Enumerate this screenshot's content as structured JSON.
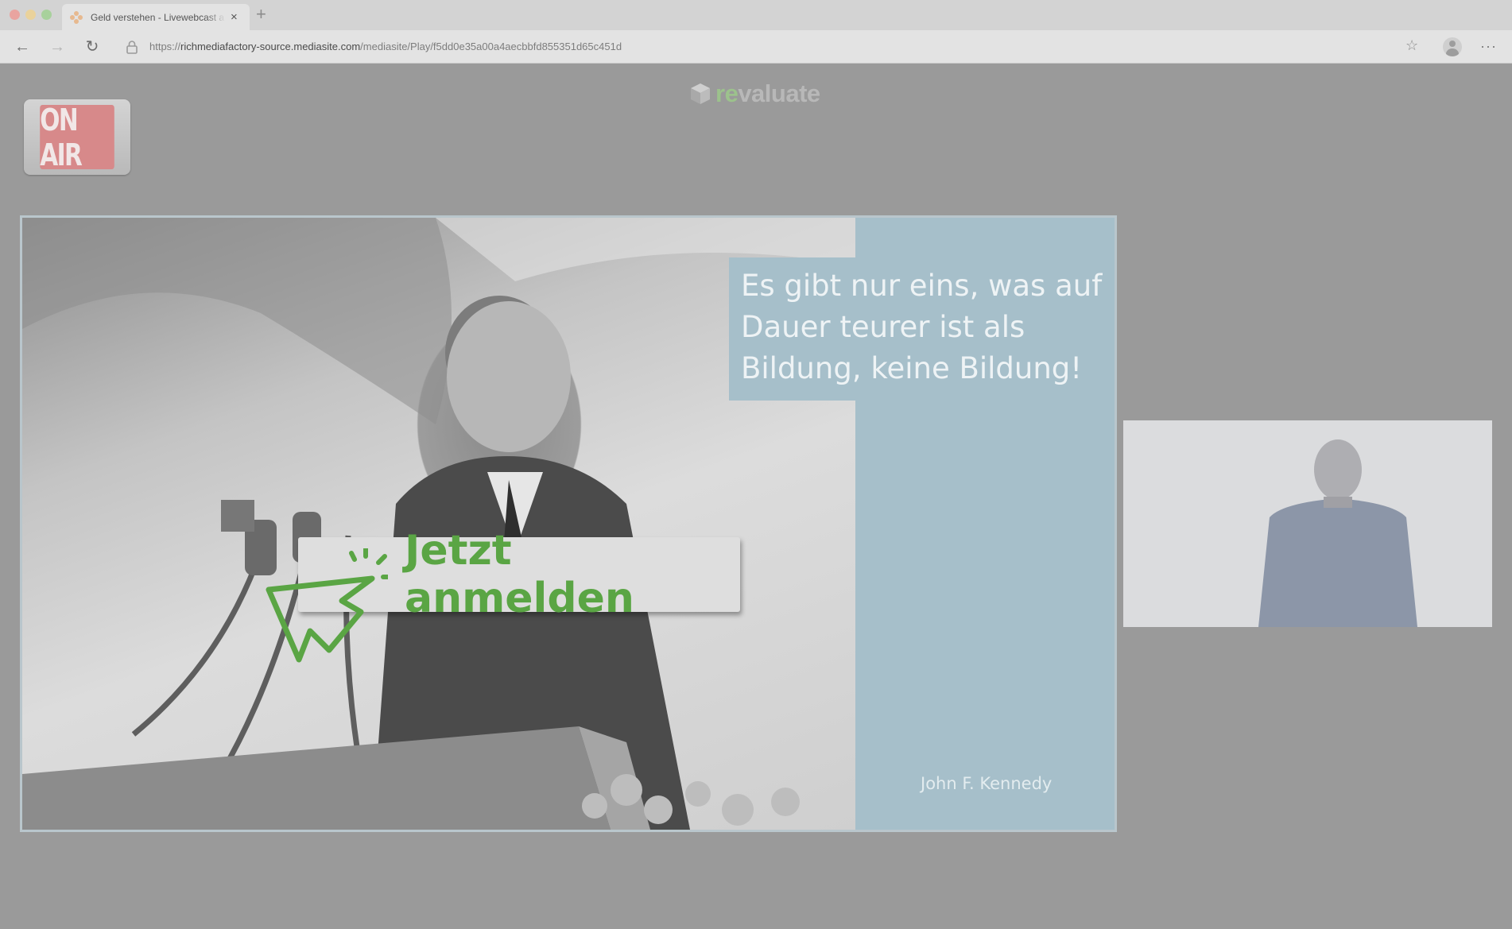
{
  "browser": {
    "tab": {
      "title": "Geld verstehen - Livewebcast a",
      "close_glyph": "×"
    },
    "new_tab_glyph": "+",
    "nav": {
      "back_glyph": "←",
      "forward_glyph": "→",
      "reload_glyph": "↻",
      "star_glyph": "☆",
      "more_glyph": "···"
    },
    "url": {
      "scheme": "https://",
      "host": "richmediafactory-source.mediasite.com",
      "path": "/mediasite/Play/f5dd0e35a00a4aecbbfd855351d65c451d"
    },
    "icons": [
      "lock-icon",
      "star-icon",
      "account-icon",
      "more-icon"
    ]
  },
  "page": {
    "logo": {
      "prefix": "re",
      "suffix": "valuate"
    },
    "on_air": "ON AIR",
    "slide": {
      "quote": "Es gibt nur eins, was auf Dauer teurer ist als Bildung, keine Bildung!",
      "author": "John F. Kennedy",
      "cta_label": "Jetzt anmelden"
    }
  },
  "colors": {
    "overlay_gray": "#9a9a9a",
    "accent_green": "#5aa544",
    "quote_panel": "#a6bfca",
    "on_air_red": "#d7898a"
  }
}
